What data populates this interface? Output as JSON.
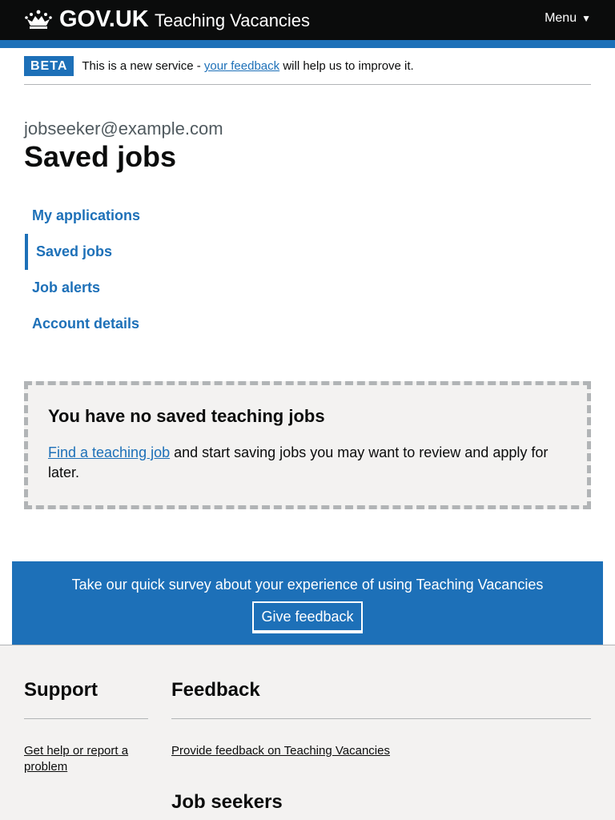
{
  "header": {
    "logo_text": "GOV.UK",
    "service_name": "Teaching Vacancies",
    "menu_label": "Menu",
    "menu_icon": "▼"
  },
  "phase_banner": {
    "tag": "BETA",
    "text_before": "This is a new service - ",
    "link_text": "your feedback",
    "text_after": " will help us to improve it."
  },
  "page": {
    "caption": "jobseeker@example.com",
    "title": "Saved jobs"
  },
  "subnav": {
    "items": [
      {
        "label": "My applications",
        "active": false
      },
      {
        "label": "Saved jobs",
        "active": true
      },
      {
        "label": "Job alerts",
        "active": false
      },
      {
        "label": "Account details",
        "active": false
      }
    ]
  },
  "empty_state": {
    "heading": "You have no saved teaching jobs",
    "link_text": "Find a teaching job",
    "text_after": " and start saving jobs you may want to review and apply for later."
  },
  "survey": {
    "text": "Take our quick survey about your experience of using Teaching Vacancies",
    "button_label": "Give feedback"
  },
  "footer": {
    "support": {
      "heading": "Support",
      "link": "Get help or report a problem"
    },
    "feedback": {
      "heading": "Feedback",
      "link": "Provide feedback on Teaching Vacancies"
    },
    "jobseekers": {
      "heading": "Job seekers"
    }
  },
  "colors": {
    "brand_blue": "#1d70b8",
    "header_black": "#0b0c0c",
    "footer_grey": "#f3f2f1"
  }
}
